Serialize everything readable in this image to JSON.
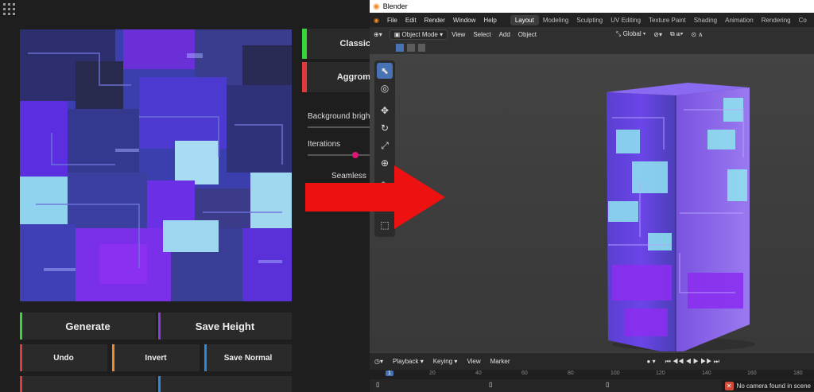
{
  "left_app": {
    "side_buttons": [
      {
        "label": "Classic",
        "color": "#3ad43a"
      },
      {
        "label": "Aggrom",
        "color": "#e03a3a"
      }
    ],
    "labels": {
      "background_brightness": "Background bright",
      "iterations": "Iterations",
      "seamless": "Seamless"
    },
    "buttons": {
      "generate": "Generate",
      "save_height": "Save Height",
      "undo": "Undo",
      "invert": "Invert",
      "save_normal": "Save Normal"
    },
    "colors": {
      "generate": "#3ad43a",
      "save_height": "#8a3adf",
      "undo": "#e03a3a",
      "invert": "#f08a24",
      "save_normal": "#2a8ae0",
      "slider_dot": "#e0157a",
      "seamless_dot": "#b8d41a"
    }
  },
  "arrow": {
    "color": "#ee1111"
  },
  "blender": {
    "title": "Blender",
    "menu": [
      "File",
      "Edit",
      "Render",
      "Window",
      "Help"
    ],
    "workspaces": [
      "Layout",
      "Modeling",
      "Sculpting",
      "UV Editing",
      "Texture Paint",
      "Shading",
      "Animation",
      "Rendering",
      "Co"
    ],
    "active_workspace": "Layout",
    "header": {
      "mode": "Object Mode",
      "view": "View",
      "select": "Select",
      "add": "Add",
      "object": "Object",
      "transform": "Global"
    },
    "timeline": {
      "playback": "Playback",
      "keying": "Keying",
      "view": "View",
      "marker": "Marker"
    },
    "ruler_ticks": [
      "1",
      "20",
      "40",
      "60",
      "80",
      "100",
      "120",
      "140",
      "160",
      "180"
    ],
    "status_message": "No camera found in scene",
    "accent": "#4772b3"
  }
}
